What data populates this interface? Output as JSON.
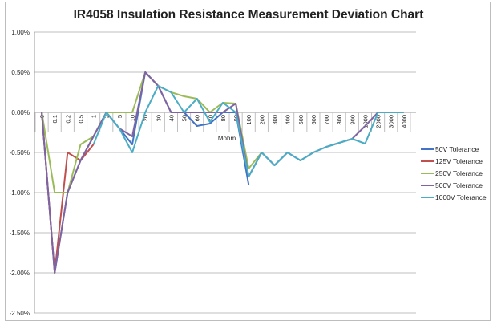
{
  "chart_data": {
    "type": "line",
    "title": "IR4058 Insulation Resistance Measurement Deviation Chart",
    "xlabel": "Mohm",
    "ylabel": "",
    "ylim": [
      -0.025,
      0.01
    ],
    "yticks": [
      "1.00%",
      "0.50%",
      "0.00%",
      "-0.50%",
      "-1.00%",
      "-1.50%",
      "-2.00%",
      "-2.50%"
    ],
    "ytick_values": [
      0.01,
      0.005,
      0,
      -0.005,
      -0.01,
      -0.015,
      -0.02,
      -0.025
    ],
    "grid": "horizontal",
    "legend_position": "right",
    "categories": [
      "0",
      "0.1",
      "0.2",
      "0.5",
      "1",
      "2",
      "5",
      "10",
      "20",
      "30",
      "40",
      "50",
      "60",
      "70",
      "80",
      "90",
      "100",
      "200",
      "300",
      "400",
      "500",
      "600",
      "700",
      "800",
      "900",
      "1000",
      "2000",
      "3000",
      "4000"
    ],
    "series": [
      {
        "name": "50V Tolerance",
        "color": "#4472c4",
        "values": [
          0,
          -0.02,
          -0.01,
          -0.006,
          -0.003,
          0,
          -0.002,
          -0.004,
          0.005,
          0.0033,
          0,
          0,
          -0.0017,
          -0.0014,
          0,
          0,
          -0.009,
          null,
          null,
          null,
          null,
          null,
          null,
          null,
          null,
          null,
          null,
          null,
          null
        ]
      },
      {
        "name": "125V Tolerance",
        "color": "#c0504d",
        "values": [
          0,
          -0.02,
          -0.005,
          -0.006,
          -0.004,
          null,
          null,
          null,
          null,
          null,
          null,
          null,
          null,
          null,
          null,
          null,
          null,
          null,
          null,
          null,
          null,
          null,
          null,
          null,
          null,
          null,
          null,
          null,
          null
        ]
      },
      {
        "name": "250V Tolerance",
        "color": "#9bbb59",
        "values": [
          0,
          -0.01,
          -0.01,
          -0.004,
          -0.003,
          0,
          0,
          0,
          0.005,
          0.0033,
          0.0025,
          0.002,
          0.0017,
          0,
          0.0012,
          0.0011,
          -0.007,
          -0.005,
          null,
          null,
          null,
          null,
          null,
          null,
          null,
          null,
          null,
          null,
          null
        ]
      },
      {
        "name": "500V Tolerance",
        "color": "#8064a2",
        "values": [
          0,
          -0.02,
          -0.01,
          -0.006,
          -0.003,
          0,
          -0.002,
          -0.003,
          0.005,
          0.0033,
          0,
          0,
          0,
          0,
          0,
          0.0011,
          -0.008,
          -0.005,
          -0.0066,
          -0.005,
          -0.006,
          -0.005,
          -0.0043,
          -0.0038,
          -0.0033,
          -0.0017,
          0,
          null,
          null
        ]
      },
      {
        "name": "1000V Tolerance",
        "color": "#4bacc6",
        "values": [
          null,
          null,
          null,
          null,
          -0.004,
          0,
          -0.002,
          -0.005,
          0,
          0.0033,
          0.0025,
          0,
          0.0017,
          -0.0012,
          0.0012,
          0,
          -0.008,
          -0.005,
          -0.0066,
          -0.005,
          -0.006,
          -0.005,
          -0.0043,
          -0.0038,
          -0.0033,
          -0.0039,
          0,
          0,
          0
        ]
      }
    ]
  }
}
